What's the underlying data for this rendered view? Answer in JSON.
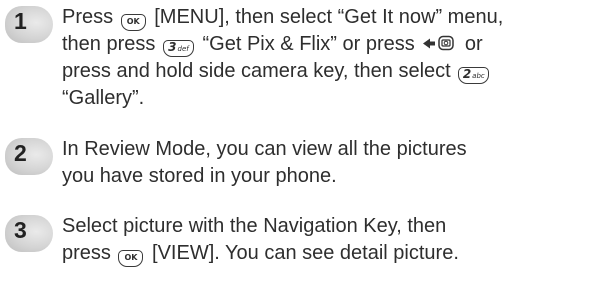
{
  "steps": [
    {
      "number": "1",
      "lines": [
        {
          "part1": "Press",
          "ok_key": "OK",
          "part2": "[MENU], then select “Get It now” menu,"
        },
        {
          "part1": "then press",
          "key_digit": "3",
          "key_letters": "def",
          "part2": "“Get Pix & Flix” or press",
          "part3": "or"
        },
        {
          "part1": "press and hold side camera key, then select",
          "key_digit": "2",
          "key_letters": "abc"
        },
        {
          "part1": "“Gallery”."
        }
      ]
    },
    {
      "number": "2",
      "lines": [
        {
          "part1": "In Review Mode, you can view all the pictures"
        },
        {
          "part1": "you have stored in your phone."
        }
      ]
    },
    {
      "number": "3",
      "lines": [
        {
          "part1": "Select picture with the Navigation Key, then"
        },
        {
          "part1": "press",
          "ok_key": "OK",
          "part2": "[VIEW]. You can see detail picture."
        }
      ]
    }
  ]
}
